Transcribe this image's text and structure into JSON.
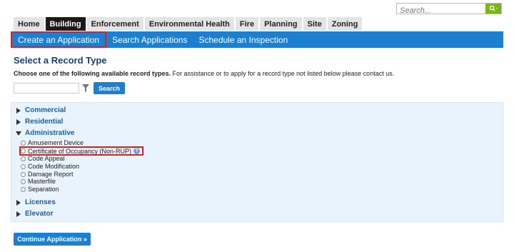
{
  "search": {
    "placeholder": "Search..."
  },
  "tabs": [
    "Home",
    "Building",
    "Enforcement",
    "Environmental Health",
    "Fire",
    "Planning",
    "Site",
    "Zoning"
  ],
  "active_tab": "Building",
  "subnav": [
    "Create an Application",
    "Search Applications",
    "Schedule an Inspection"
  ],
  "page": {
    "heading": "Select a Record Type",
    "instruction_bold": "Choose one of the following available record types.",
    "instruction_rest": " For assistance or to apply for a record type not listed below please contact us.",
    "search_button": "Search"
  },
  "groups": {
    "commercial": "Commercial",
    "residential": "Residential",
    "administrative": "Administrative",
    "licenses": "Licenses",
    "elevator": "Elevator"
  },
  "admin_items": [
    "Amusement Device",
    "Certificate of Occupancy (Non-RUP)",
    "Code Appeal",
    "Code Modification",
    "Damage Report",
    "Masterfile",
    "Separation"
  ],
  "continue_button": "Continue Application »",
  "colors": {
    "nav_blue": "#1c7fd0",
    "highlight_red": "#e02020",
    "panel_bg": "#e8f3fb",
    "search_green": "#7cb518"
  }
}
